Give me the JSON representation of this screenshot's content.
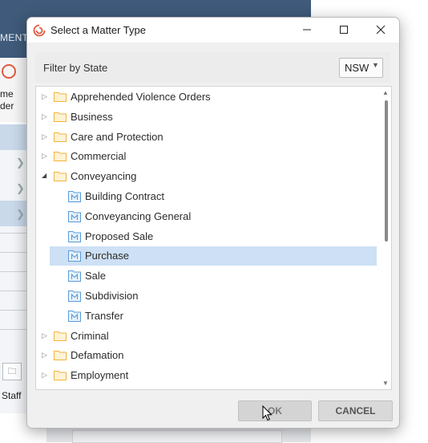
{
  "background": {
    "menu_fragment": "MENTS",
    "icon_text_line1": "me",
    "icon_text_line2": "der",
    "staff_label": "Staff"
  },
  "dialog": {
    "title": "Select a Matter Type",
    "titlebar_buttons": [
      "minimize-icon",
      "maximize-icon",
      "close-icon"
    ],
    "filter_label": "Filter by State",
    "state_value": "NSW",
    "tree": [
      {
        "label": "Apprehended Violence Orders",
        "level": 0,
        "type": "folder",
        "expanded": false
      },
      {
        "label": "Business",
        "level": 0,
        "type": "folder",
        "expanded": false
      },
      {
        "label": "Care and Protection",
        "level": 0,
        "type": "folder",
        "expanded": false
      },
      {
        "label": "Commercial",
        "level": 0,
        "type": "folder",
        "expanded": false
      },
      {
        "label": "Conveyancing",
        "level": 0,
        "type": "folder",
        "expanded": true
      },
      {
        "label": "Building Contract",
        "level": 1,
        "type": "matter",
        "selected": false
      },
      {
        "label": "Conveyancing General",
        "level": 1,
        "type": "matter",
        "selected": false
      },
      {
        "label": "Proposed Sale",
        "level": 1,
        "type": "matter",
        "selected": false
      },
      {
        "label": "Purchase",
        "level": 1,
        "type": "matter",
        "selected": true
      },
      {
        "label": "Sale",
        "level": 1,
        "type": "matter",
        "selected": false
      },
      {
        "label": "Subdivision",
        "level": 1,
        "type": "matter",
        "selected": false
      },
      {
        "label": "Transfer",
        "level": 1,
        "type": "matter",
        "selected": false
      },
      {
        "label": "Criminal",
        "level": 0,
        "type": "folder",
        "expanded": false
      },
      {
        "label": "Defamation",
        "level": 0,
        "type": "folder",
        "expanded": false
      },
      {
        "label": "Employment",
        "level": 0,
        "type": "folder",
        "expanded": false
      }
    ],
    "ok_label": "OK",
    "cancel_label": "CANCEL"
  },
  "colors": {
    "folder": "#f2b33d",
    "matter_icon": "#5a9bd8",
    "selection": "#cde0f5",
    "brand": "#e35a42"
  }
}
